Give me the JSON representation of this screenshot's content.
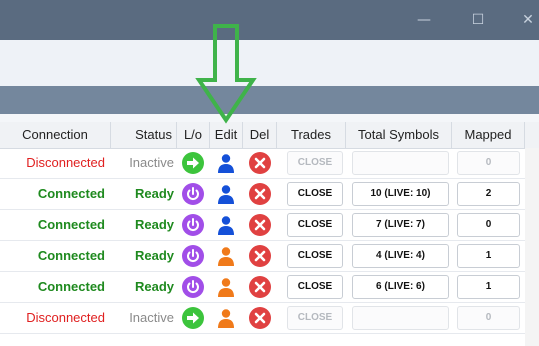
{
  "window": {
    "minimize_icon": "minimize-icon",
    "maximize_icon": "maximize-icon",
    "close_icon": "close-icon"
  },
  "colors": {
    "connected": "#1f8a1f",
    "disconnected": "#e02020",
    "inactive": "#8a8a8a",
    "login_green": "#3cc43c",
    "power_purple": "#a14ee8",
    "user_blue": "#1450d8",
    "user_orange": "#f07a1a",
    "delete_red": "#e04141",
    "arrow_green": "#3fb34a"
  },
  "grid": {
    "headers": {
      "connection": "Connection",
      "status": "Status",
      "lo": "L/o",
      "edit": "Edit",
      "del": "Del",
      "trades": "Trades",
      "total_symbols": "Total Symbols",
      "mapped": "Mapped"
    },
    "rows": [
      {
        "connection": "Disconnected",
        "connected": false,
        "status": "Inactive",
        "action_icon": "login-arrow-icon",
        "user_icon": "user-blue-icon",
        "trades": "CLOSE",
        "trades_enabled": false,
        "total_symbols": "",
        "mapped": "0"
      },
      {
        "connection": "Connected",
        "connected": true,
        "status": "Ready",
        "action_icon": "power-icon",
        "user_icon": "user-blue-icon",
        "trades": "CLOSE",
        "trades_enabled": true,
        "total_symbols": "10 (LIVE: 10)",
        "mapped": "2"
      },
      {
        "connection": "Connected",
        "connected": true,
        "status": "Ready",
        "action_icon": "power-icon",
        "user_icon": "user-blue-icon",
        "trades": "CLOSE",
        "trades_enabled": true,
        "total_symbols": "7 (LIVE: 7)",
        "mapped": "0"
      },
      {
        "connection": "Connected",
        "connected": true,
        "status": "Ready",
        "action_icon": "power-icon",
        "user_icon": "user-orange-icon",
        "trades": "CLOSE",
        "trades_enabled": true,
        "total_symbols": "4 (LIVE: 4)",
        "mapped": "1"
      },
      {
        "connection": "Connected",
        "connected": true,
        "status": "Ready",
        "action_icon": "power-icon",
        "user_icon": "user-orange-icon",
        "trades": "CLOSE",
        "trades_enabled": true,
        "total_symbols": "6 (LIVE: 6)",
        "mapped": "1"
      },
      {
        "connection": "Disconnected",
        "connected": false,
        "status": "Inactive",
        "action_icon": "login-arrow-icon",
        "user_icon": "user-orange-icon",
        "trades": "CLOSE",
        "trades_enabled": false,
        "total_symbols": "",
        "mapped": "0"
      }
    ]
  }
}
